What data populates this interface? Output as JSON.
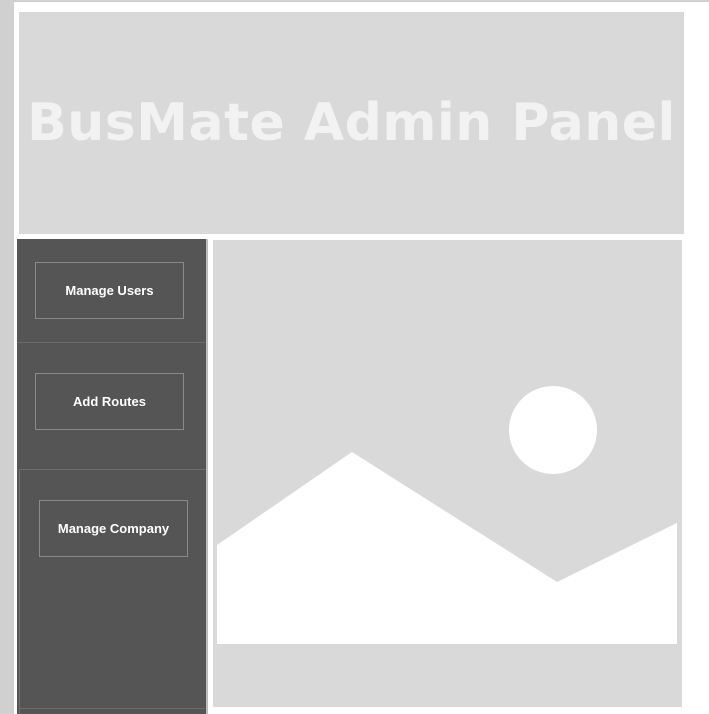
{
  "header": {
    "title": "BusMate Admin Panel"
  },
  "sidebar": {
    "items": [
      {
        "label": "Manage Users"
      },
      {
        "label": "Add Routes"
      },
      {
        "label": "Manage Company"
      }
    ]
  },
  "main": {
    "image_icon": "image-placeholder-icon"
  },
  "colors": {
    "header_bg": "#d9d9d9",
    "header_text": "#f2f2f2",
    "sidebar_bg": "#555555",
    "content_bg": "#d9d9d9"
  }
}
